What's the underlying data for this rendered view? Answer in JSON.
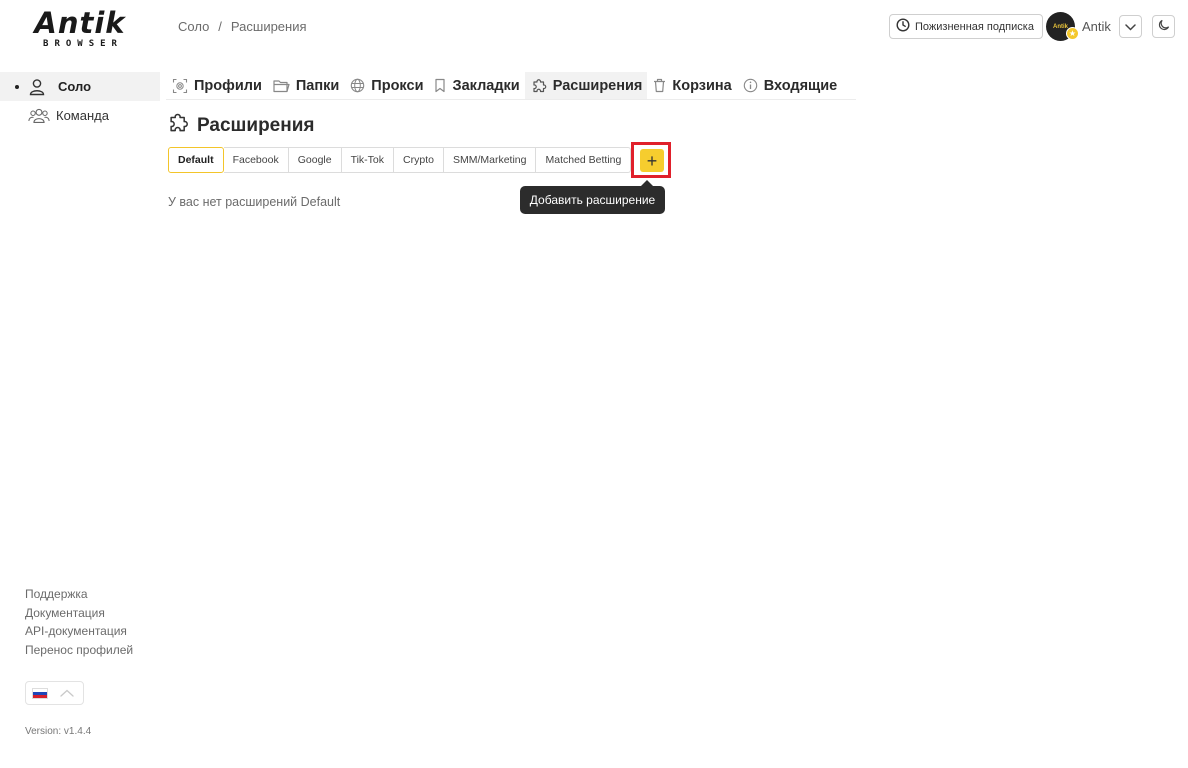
{
  "logo": {
    "main": "Antik",
    "sub": "BROWSER"
  },
  "breadcrumb": {
    "items": [
      "Соло",
      "/",
      "Расширения"
    ]
  },
  "header": {
    "subscription_label": "Пожизненная подписка",
    "avatar_text": "Antik",
    "username": "Antik"
  },
  "sidebar": {
    "items": [
      {
        "label": "Соло",
        "icon": "user-icon",
        "active": true
      },
      {
        "label": "Команда",
        "icon": "users-icon",
        "active": false
      }
    ],
    "footer_links": [
      "Поддержка",
      "Документация",
      "API-документация",
      "Перенос профилей"
    ],
    "language": "ru",
    "version": "Version: v1.4.4"
  },
  "topnav": {
    "items": [
      {
        "label": "Профили",
        "icon": "fingerprint-icon"
      },
      {
        "label": "Папки",
        "icon": "folder-icon"
      },
      {
        "label": "Прокси",
        "icon": "globe-icon"
      },
      {
        "label": "Закладки",
        "icon": "bookmark-icon"
      },
      {
        "label": "Расширения",
        "icon": "puzzle-icon",
        "active": true
      },
      {
        "label": "Корзина",
        "icon": "trash-icon"
      },
      {
        "label": "Входящие",
        "icon": "info-icon"
      }
    ]
  },
  "page": {
    "title": "Расширения",
    "tabs": [
      "Default",
      "Facebook",
      "Google",
      "Tik-Tok",
      "Crypto",
      "SMM/Marketing",
      "Matched Betting"
    ],
    "active_tab": "Default",
    "add_button": "+",
    "tooltip": "Добавить расширение",
    "empty_message": "У вас нет расширений Default"
  },
  "colors": {
    "accent": "#f6cd2e",
    "highlight": "#e0202b",
    "tooltip_bg": "#2c2c2c"
  }
}
